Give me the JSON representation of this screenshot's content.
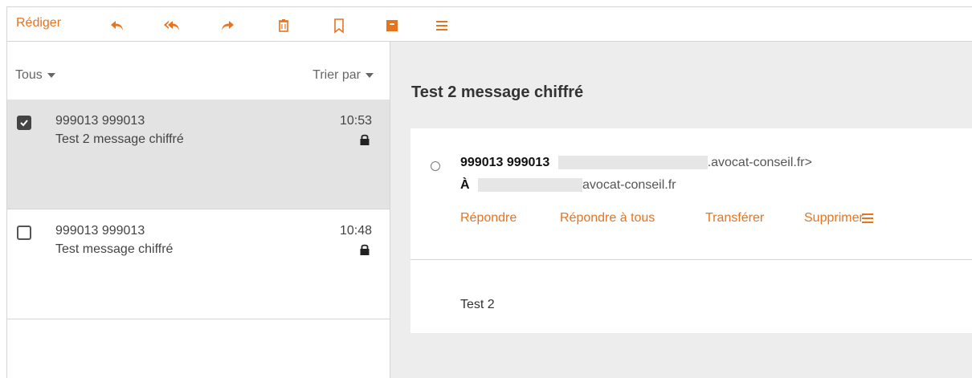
{
  "toolbar": {
    "compose_label": "Rédiger",
    "icons": [
      "reply-icon",
      "reply-all-icon",
      "forward-icon",
      "trash-icon",
      "bookmark-icon",
      "archive-icon",
      "menu-icon"
    ],
    "accent_color": "#e8731f"
  },
  "list": {
    "filter_label": "Tous",
    "sort_label": "Trier par",
    "messages": [
      {
        "from": "999013 999013",
        "subject": "Test 2 message chiffré",
        "time": "10:53",
        "selected": true,
        "checked": true,
        "encrypted": true
      },
      {
        "from": "999013 999013",
        "subject": "Test message chiffré",
        "time": "10:48",
        "selected": false,
        "checked": false,
        "encrypted": true
      }
    ]
  },
  "reader": {
    "title": "Test 2 message chiffré",
    "from_name": "999013 999013",
    "from_domain": ".avocat-conseil.fr>",
    "to_label": "À",
    "to_domain": "avocat-conseil.fr",
    "actions": {
      "reply": "Répondre",
      "reply_all": "Répondre à tous",
      "forward": "Transférer",
      "delete": "Supprimer"
    },
    "body": "Test 2"
  },
  "colors": {
    "selected_bg": "#e3e3e3",
    "reader_bg": "#ededed",
    "border": "#d5d5d5"
  }
}
